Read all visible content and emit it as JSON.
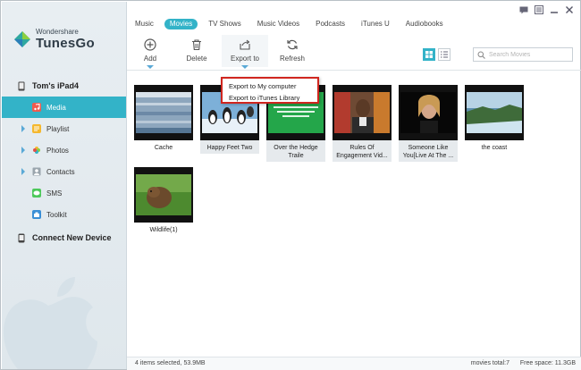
{
  "app": {
    "brand": "Wondershare",
    "name": "TunesGo"
  },
  "device": {
    "name": "Tom's iPad4"
  },
  "sidebar": {
    "items": [
      {
        "label": "Media",
        "icon": "music-note-icon",
        "active": true
      },
      {
        "label": "Playlist",
        "icon": "playlist-icon",
        "expandable": true
      },
      {
        "label": "Photos",
        "icon": "photos-icon",
        "expandable": true
      },
      {
        "label": "Contacts",
        "icon": "contacts-icon",
        "expandable": true
      },
      {
        "label": "SMS",
        "icon": "sms-icon"
      },
      {
        "label": "Toolkit",
        "icon": "toolkit-icon"
      }
    ],
    "connect_label": "Connect New Device"
  },
  "tabs": [
    {
      "label": "Music"
    },
    {
      "label": "Movies",
      "active": true
    },
    {
      "label": "TV Shows"
    },
    {
      "label": "Music Videos"
    },
    {
      "label": "Podcasts"
    },
    {
      "label": "iTunes U"
    },
    {
      "label": "Audiobooks"
    }
  ],
  "toolbar": {
    "add_label": "Add",
    "delete_label": "Delete",
    "export_label": "Export to",
    "refresh_label": "Refresh"
  },
  "search": {
    "placeholder": "Search Movies"
  },
  "export_menu": {
    "items": [
      {
        "label": "Export to My computer"
      },
      {
        "label": "Export to iTunes Library"
      }
    ]
  },
  "movies": [
    {
      "title": "Cache",
      "selected": false
    },
    {
      "title": "Happy Feet Two",
      "selected": true
    },
    {
      "title": "Over the Hedge Traile",
      "selected": true
    },
    {
      "title": "Rules Of Engagement Vid...",
      "selected": true
    },
    {
      "title": "Someone Like You[Live At The ...",
      "selected": true
    },
    {
      "title": "the coast",
      "selected": false
    },
    {
      "title": "Wildlife(1)",
      "selected": false
    }
  ],
  "status": {
    "selected": "4 items selected, 53.9MB",
    "total": "movies total:7",
    "free_space": "Free space: 11.3GB"
  },
  "colors": {
    "accent": "#33b3c8",
    "menu_border": "#d0261f"
  }
}
